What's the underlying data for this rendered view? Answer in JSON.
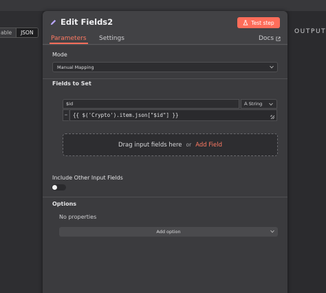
{
  "left_pane": {
    "toggle": [
      "able",
      "JSON"
    ]
  },
  "right_pane": {
    "title": "OUTPUT"
  },
  "panel": {
    "title": "Edit Fields2",
    "test_button": "Test step",
    "tabs": [
      {
        "label": "Parameters",
        "active": true
      },
      {
        "label": "Settings",
        "active": false
      }
    ],
    "docs_link": "Docs",
    "mode": {
      "label": "Mode",
      "value": "Manual Mapping"
    },
    "fields_to_set": {
      "label": "Fields to Set",
      "fields": [
        {
          "name": "$id",
          "type": "String",
          "type_icon": "A",
          "value": "{{ $('Crypto').item.json[\"$id\"] }}"
        }
      ],
      "drop_text": "Drag input fields here",
      "drop_or": "or",
      "add_field": "Add Field"
    },
    "include_other": {
      "label": "Include Other Input Fields",
      "enabled": false
    },
    "options": {
      "label": "Options",
      "empty_text": "No properties",
      "add_option": "Add option"
    }
  },
  "colors": {
    "accent": "#ff6d5a",
    "panel": "#424245",
    "body": "#3b3b3e",
    "input": "#2d2d30"
  }
}
